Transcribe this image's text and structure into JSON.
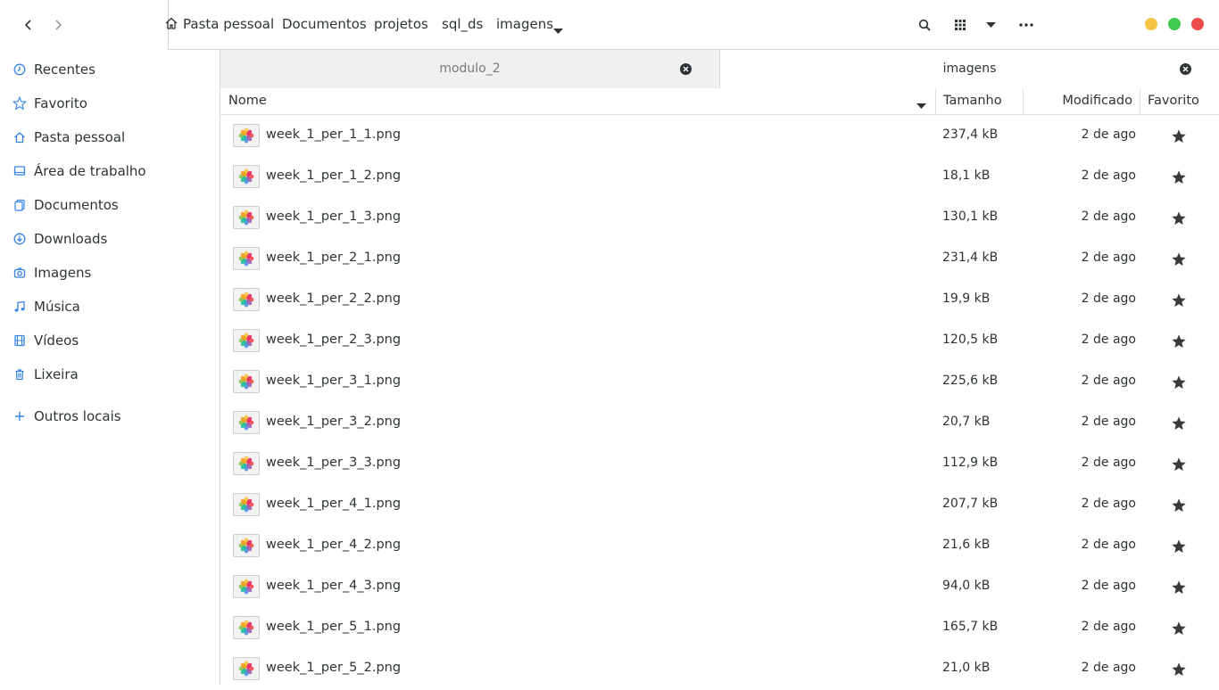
{
  "header": {
    "breadcrumbs": [
      "Pasta pessoal",
      "Documentos",
      "projetos",
      "sql_ds",
      "imagens"
    ]
  },
  "sidebar": {
    "items": [
      {
        "label": "Recentes",
        "icon": "clock-icon"
      },
      {
        "label": "Favorito",
        "icon": "star-outline-icon"
      },
      {
        "label": "Pasta pessoal",
        "icon": "home-icon"
      },
      {
        "label": "Área de trabalho",
        "icon": "desktop-icon"
      },
      {
        "label": "Documentos",
        "icon": "document-icon"
      },
      {
        "label": "Downloads",
        "icon": "download-icon"
      },
      {
        "label": "Imagens",
        "icon": "camera-icon"
      },
      {
        "label": "Música",
        "icon": "music-note-icon"
      },
      {
        "label": "Vídeos",
        "icon": "film-icon"
      },
      {
        "label": "Lixeira",
        "icon": "trash-icon"
      }
    ],
    "other_locations": "Outros locais"
  },
  "tabs": [
    {
      "label": "modulo_2",
      "active": false
    },
    {
      "label": "imagens",
      "active": true
    }
  ],
  "columns": {
    "name": "Nome",
    "size": "Tamanho",
    "modified": "Modificado",
    "favorite": "Favorito"
  },
  "files": [
    {
      "name": "week_1_per_1_1.png",
      "size": "237,4 kB",
      "modified": "2 de ago"
    },
    {
      "name": "week_1_per_1_2.png",
      "size": "18,1 kB",
      "modified": "2 de ago"
    },
    {
      "name": "week_1_per_1_3.png",
      "size": "130,1 kB",
      "modified": "2 de ago"
    },
    {
      "name": "week_1_per_2_1.png",
      "size": "231,4 kB",
      "modified": "2 de ago"
    },
    {
      "name": "week_1_per_2_2.png",
      "size": "19,9 kB",
      "modified": "2 de ago"
    },
    {
      "name": "week_1_per_2_3.png",
      "size": "120,5 kB",
      "modified": "2 de ago"
    },
    {
      "name": "week_1_per_3_1.png",
      "size": "225,6 kB",
      "modified": "2 de ago"
    },
    {
      "name": "week_1_per_3_2.png",
      "size": "20,7 kB",
      "modified": "2 de ago"
    },
    {
      "name": "week_1_per_3_3.png",
      "size": "112,9 kB",
      "modified": "2 de ago"
    },
    {
      "name": "week_1_per_4_1.png",
      "size": "207,7 kB",
      "modified": "2 de ago"
    },
    {
      "name": "week_1_per_4_2.png",
      "size": "21,6 kB",
      "modified": "2 de ago"
    },
    {
      "name": "week_1_per_4_3.png",
      "size": "94,0 kB",
      "modified": "2 de ago"
    },
    {
      "name": "week_1_per_5_1.png",
      "size": "165,7 kB",
      "modified": "2 de ago"
    },
    {
      "name": "week_1_per_5_2.png",
      "size": "21,0 kB",
      "modified": "2 de ago"
    }
  ],
  "colors": {
    "accent": "#3584e4",
    "window_minimize": "#f6c445",
    "window_maximize": "#3fc94f",
    "window_close": "#ef4b4b",
    "star": "#3a3a3a"
  }
}
